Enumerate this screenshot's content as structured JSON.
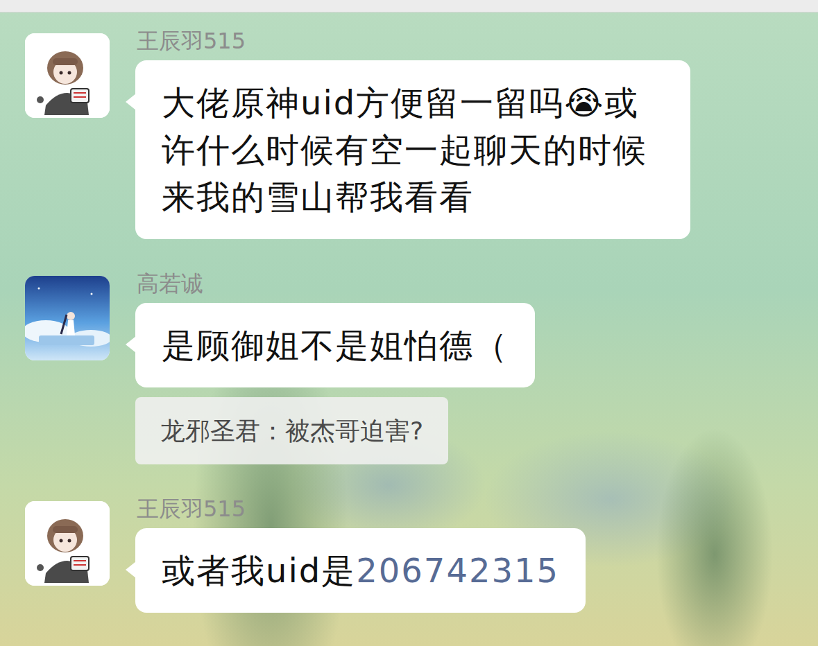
{
  "messages": [
    {
      "sender": "王辰羽515",
      "parts": [
        {
          "kind": "text",
          "text": "大佬原神uid方便留一留吗"
        },
        {
          "kind": "text",
          "text": "😭"
        },
        {
          "kind": "text",
          "text": "或许什么时候有空一起聊天的时候来我的雪山帮我看看"
        }
      ]
    },
    {
      "sender": "高若诚",
      "parts": [
        {
          "kind": "text",
          "text": "是顾御姐不是姐怕德（"
        }
      ],
      "quote": "龙邪圣君：被杰哥迫害?"
    },
    {
      "sender": "王辰羽515",
      "parts": [
        {
          "kind": "text",
          "text": "或者我uid是"
        },
        {
          "kind": "link",
          "text": "206742315"
        }
      ]
    }
  ]
}
